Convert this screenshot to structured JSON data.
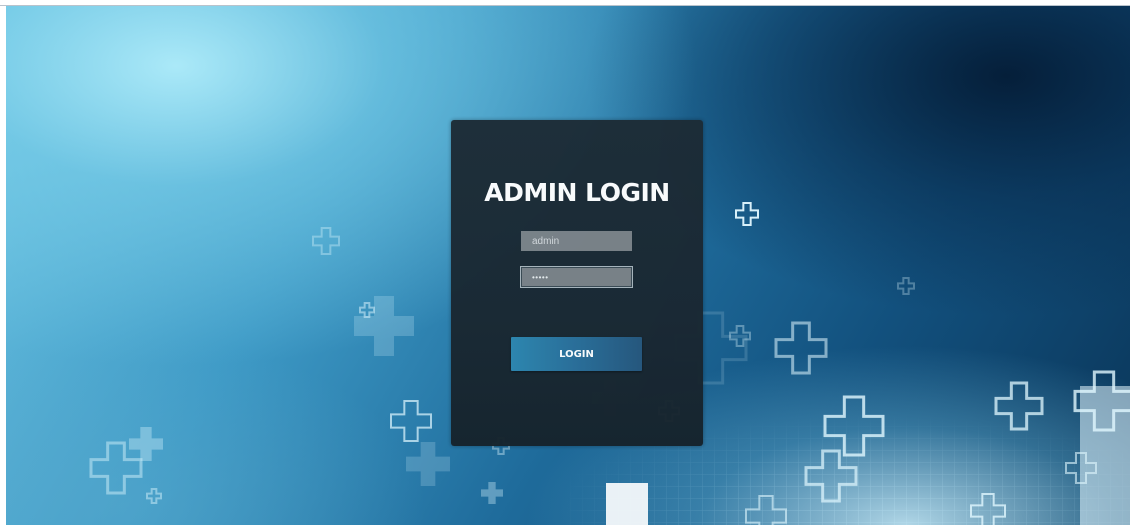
{
  "login": {
    "title": "ADMIN LOGIN",
    "username_value": "admin",
    "password_value": "passw",
    "button_label": "LOGIN"
  },
  "icons": {
    "decoration": "medical-cross-icon"
  },
  "colors": {
    "panel": "#1c2a34",
    "button": "#2a6f99",
    "field": "#7b8287",
    "title": "#ffffff"
  }
}
